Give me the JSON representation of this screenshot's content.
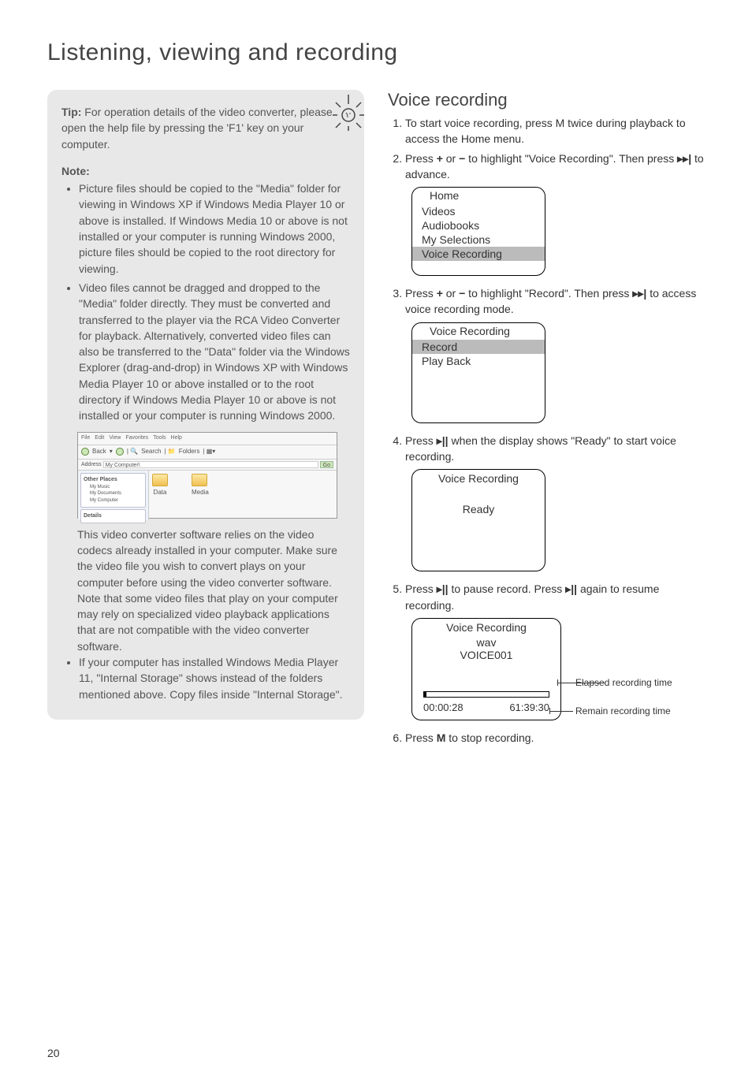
{
  "page_title": "Listening, viewing and recording",
  "page_number": "20",
  "tip": {
    "label": "Tip:",
    "intro": "For operation details of the video converter, please open the help file by pressing the 'F1' key on your computer.",
    "note_label": "Note:",
    "bullets": [
      "Picture files should be copied to the \"Media\" folder for viewing in Windows XP if Windows Media Player 10 or above is installed. If Windows Media 10 or above is not installed or your computer is running Windows 2000, picture files should be copied to the root directory for viewing.",
      "Video files cannot be dragged and dropped to the \"Media\" folder directly. They must be converted and transferred to the player via the RCA Video Converter for playback. Alternatively, converted video files can also be transferred  to the \"Data\" folder via the Windows Explorer (drag-and-drop) in Windows XP with Windows Media Player 10 or above installed or to the root directory if Windows Media Player 10 or above is not installed or your computer is running Windows 2000."
    ],
    "after_shot": "This video converter software relies on the video codecs already installed in your computer.  Make sure the video file you wish to convert plays on your computer before using the video converter software. Note that some video files that play on your computer may rely on specialized video playback applications that are not compatible with the video converter software.",
    "bullet3": "If your computer has installed Windows Media Player 11, \"Internal Storage\" shows instead of the folders mentioned above. Copy files inside \"Internal Storage\"."
  },
  "explorer": {
    "menu": {
      "file": "File",
      "edit": "Edit",
      "view": "View",
      "fav": "Favorites",
      "tools": "Tools",
      "help": "Help"
    },
    "back": "Back",
    "search": "Search",
    "folders": "Folders",
    "address_label": "Address",
    "address_value": "My Computer\\",
    "other_places": "Other Places",
    "my_music": "My Music",
    "my_documents": "My Documents",
    "my_computer": "My Computer",
    "details": "Details",
    "go": "Go",
    "folder_data": "Data",
    "folder_media": "Media"
  },
  "voice": {
    "heading": "Voice recording",
    "steps": [
      "To start voice recording, press M twice during playback to access the Home menu.",
      "Press + or − to highlight \"Voice Recording\". Then press ▸▸| to advance.",
      "Press + or − to highlight \"Record\". Then press ▸▸| to access voice recording mode.",
      "Press ▸|| when the display shows \"Ready\" to start voice recording.",
      "Press ▸|| to pause record. Press ▸|| again to resume recording.",
      "Press M to stop recording."
    ],
    "screen1": {
      "hdr": "Home",
      "items": [
        "Videos",
        "Audiobooks",
        "My Selections",
        "Voice Recording"
      ]
    },
    "screen2": {
      "hdr": "Voice Recording",
      "items": [
        "Record",
        "Play Back"
      ]
    },
    "screen3": {
      "hdr": "Voice Recording",
      "ready": "Ready"
    },
    "screen4": {
      "hdr": "Voice Recording",
      "fmt": "wav",
      "name": "VOICE001",
      "elapsed": "00:00:28",
      "remain": "61:39:30"
    },
    "annot": {
      "elapsed": "Elapsed recording time",
      "remain": "Remain recording time"
    }
  }
}
